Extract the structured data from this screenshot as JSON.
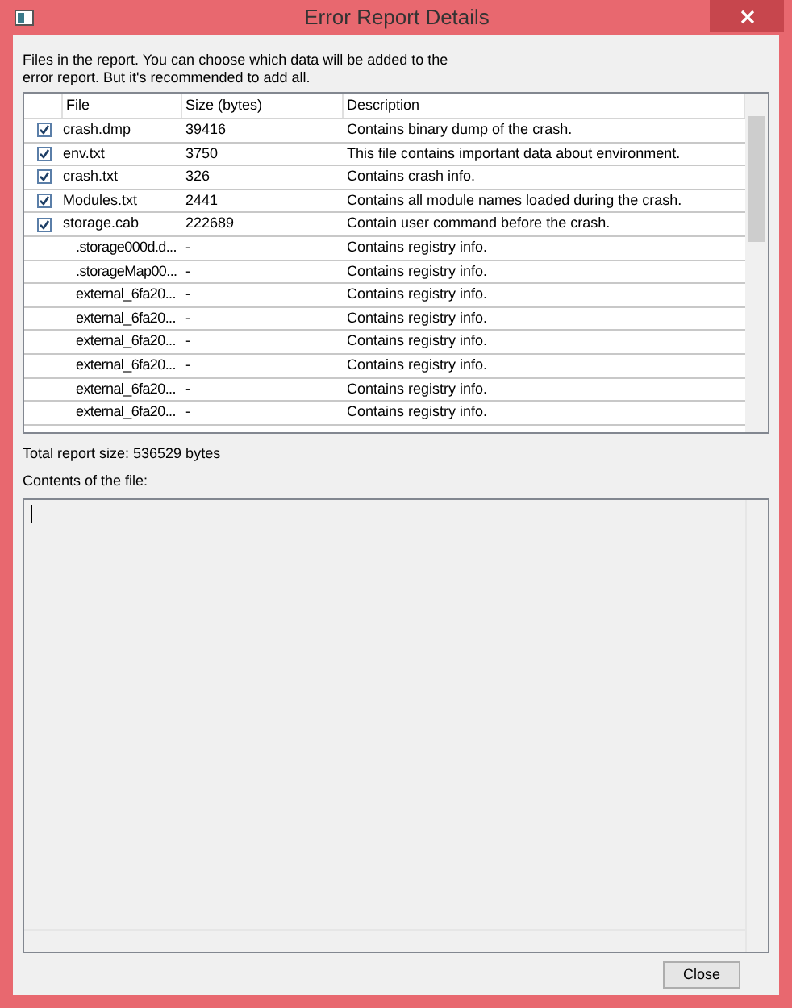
{
  "window": {
    "title": "Error Report Details"
  },
  "intro": "Files in the report. You can choose which data will be added to the error report. But it's recommended to add all.",
  "table": {
    "columns": [
      "File",
      "Size (bytes)",
      "Description"
    ],
    "rows": [
      {
        "file": "crash.dmp",
        "size": "39416",
        "description": "Contains binary dump of the crash.",
        "checked": true
      },
      {
        "file": "env.txt",
        "size": "3750",
        "description": "This file contains important data about environment.",
        "checked": true
      },
      {
        "file": "crash.txt",
        "size": "326",
        "description": "Contains crash info.",
        "checked": true
      },
      {
        "file": "Modules.txt",
        "size": "2441",
        "description": "Contains all module names loaded during the crash.",
        "checked": true
      },
      {
        "file": "storage.cab",
        "size": "222689",
        "description": "Contain user command before the crash.",
        "checked": true,
        "children": [
          {
            "file": ".storage000d.d...",
            "size": "-",
            "description": "Contains registry info."
          },
          {
            "file": ".storageMap00...",
            "size": "-",
            "description": "Contains registry info."
          },
          {
            "file": "external_6fa20...",
            "size": "-",
            "description": "Contains registry info."
          },
          {
            "file": "external_6fa20...",
            "size": "-",
            "description": "Contains registry info."
          },
          {
            "file": "external_6fa20...",
            "size": "-",
            "description": "Contains registry info."
          },
          {
            "file": "external_6fa20...",
            "size": "-",
            "description": "Contains registry info."
          },
          {
            "file": "external_6fa20...",
            "size": "-",
            "description": "Contains registry info."
          },
          {
            "file": "external_6fa20...",
            "size": "-",
            "description": "Contains registry info."
          }
        ]
      }
    ]
  },
  "total": "Total report size: 536529 bytes",
  "contents_label": "Contents of the file:",
  "buttons": [
    "Close"
  ]
}
